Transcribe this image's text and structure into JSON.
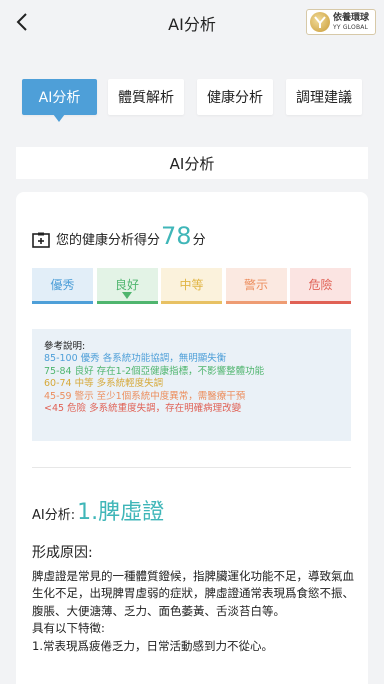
{
  "header": {
    "back_icon": "chevron-left-icon",
    "title": "AI分析",
    "logo": {
      "name_cn": "依養環球",
      "name_en": "YY GLOBAL"
    }
  },
  "tabs": [
    {
      "label": "AI分析",
      "active": true
    },
    {
      "label": "體質解析",
      "active": false
    },
    {
      "label": "健康分析",
      "active": false
    },
    {
      "label": "調理建議",
      "active": false
    }
  ],
  "section_title": "AI分析",
  "score": {
    "icon": "clipboard-plus-icon",
    "label": "您的健康分析得分",
    "value": "78",
    "unit": "分"
  },
  "levels": [
    {
      "label": "優秀",
      "bg": "#e2eef8",
      "border": "#4e9fd8",
      "color": "#4e9fd8",
      "selected": false
    },
    {
      "label": "良好",
      "bg": "#e3f3e6",
      "border": "#4fb56e",
      "color": "#4fb56e",
      "selected": true
    },
    {
      "label": "中等",
      "bg": "#fbf2dc",
      "border": "#e8c163",
      "color": "#e1b545",
      "selected": false
    },
    {
      "label": "警示",
      "bg": "#fbe9e1",
      "border": "#ee9c73",
      "color": "#ec8e5e",
      "selected": false
    },
    {
      "label": "危險",
      "bg": "#fbe4e2",
      "border": "#e06155",
      "color": "#e06155",
      "selected": false
    }
  ],
  "reference": {
    "title": "參考說明:",
    "lines": [
      {
        "text": "85-100 優秀 各系統功能協調，無明顯失衡",
        "color": "#4e9fd8"
      },
      {
        "text": "75-84 良好 存在1-2個亞健康指標，不影響整體功能",
        "color": "#4fb56e"
      },
      {
        "text": "60-74 中等 多系統輕度失調",
        "color": "#d6a93a"
      },
      {
        "text": "45-59 警示 至少1個系統中度異常，需醫療干預",
        "color": "#ec8e5e"
      },
      {
        "text": "<45 危險 多系統重度失調，存在明確病理改變",
        "color": "#e06155"
      }
    ]
  },
  "ai_result": {
    "label": "AI分析:",
    "value": "1.脾虛證"
  },
  "cause": {
    "title": "形成原因:",
    "paragraph": "脾虛證是常見的一種體質鐙候，指脾臟運化功能不足，導致氣血生化不足，出現脾胃虛弱的症狀，脾虛證通常表現爲食慾不振、腹脹、大便溏薄、乏力、面色萎黃、舌淡苔白等。",
    "features_title": "具有以下特徵:",
    "feature_1": "1.常表現爲疲倦乏力，日常活動感到力不從心。"
  }
}
